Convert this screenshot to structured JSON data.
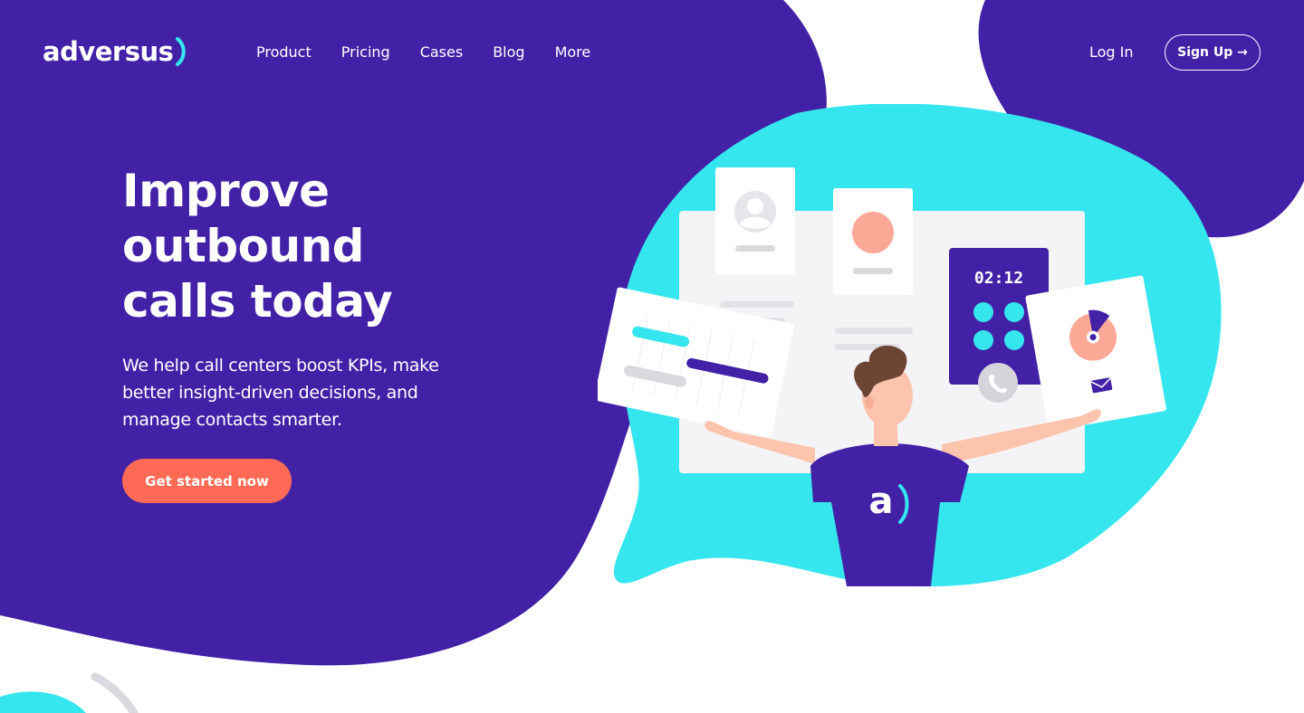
{
  "brand": {
    "name": "adversus",
    "colors": {
      "primary": "#4321a6",
      "accent": "#35e6ef",
      "cta": "#fe6a55",
      "peach": "#fca896"
    }
  },
  "nav": {
    "items": [
      {
        "label": "Product"
      },
      {
        "label": "Pricing"
      },
      {
        "label": "Cases"
      },
      {
        "label": "Blog"
      },
      {
        "label": "More"
      }
    ],
    "login_label": "Log In",
    "signup_label": "Sign Up →"
  },
  "hero": {
    "title_lines": [
      "Improve",
      "outbound",
      "calls today"
    ],
    "subtitle": "We help call centers boost KPIs, make better insight-driven decisions, and manage contacts smarter.",
    "cta_label": "Get started now"
  },
  "illustration": {
    "dialer_time": "02:12",
    "shirt_logo": "a",
    "icons": [
      "avatar-icon",
      "phone-icon",
      "mail-icon",
      "pie-chart-icon"
    ]
  }
}
